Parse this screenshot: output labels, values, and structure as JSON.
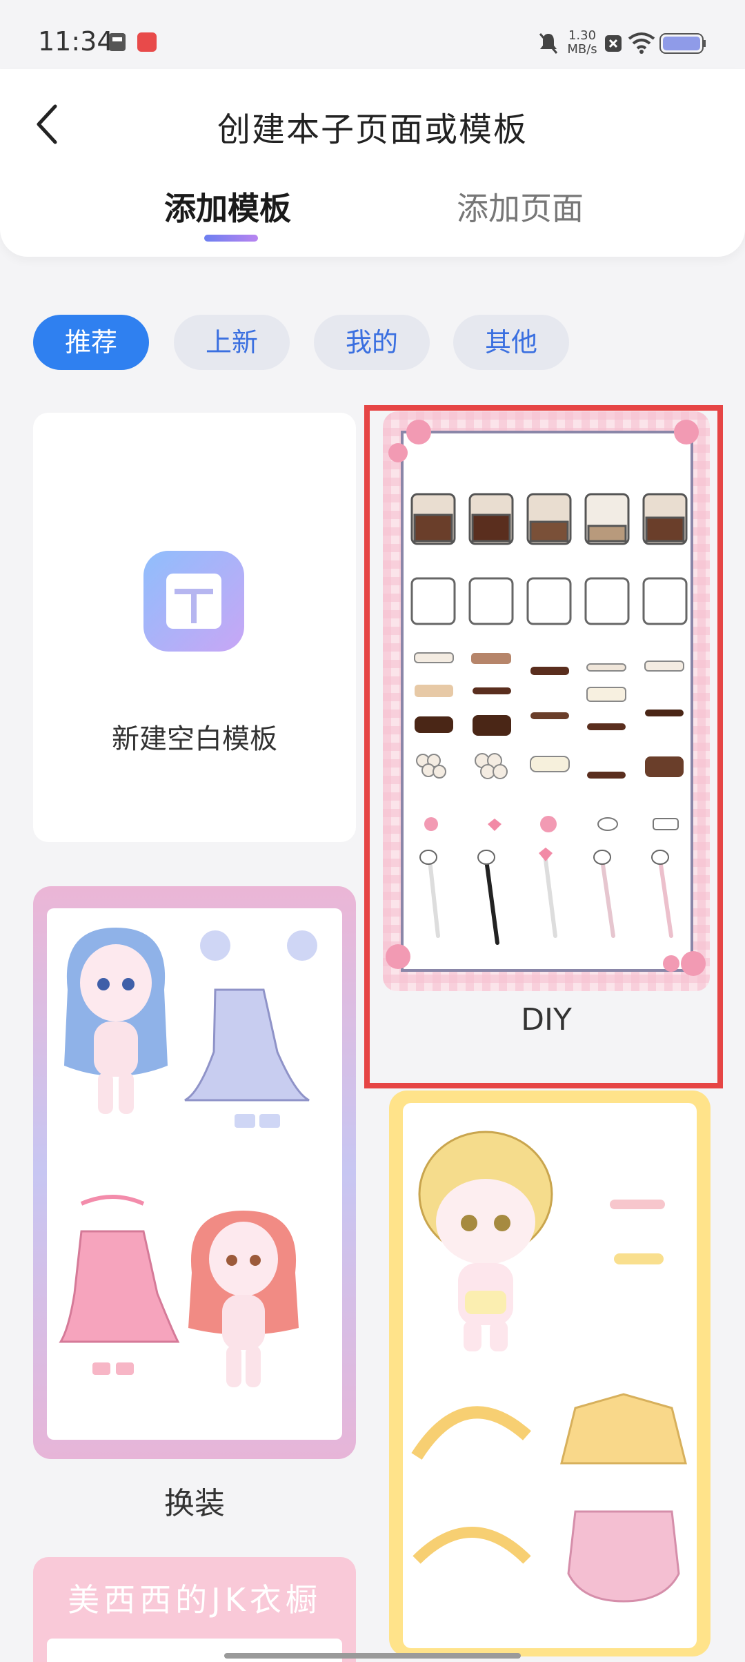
{
  "status_bar": {
    "time": "11:34",
    "speed_value": "1.30",
    "speed_unit": "MB/s"
  },
  "header": {
    "title": "创建本子页面或模板"
  },
  "tabs": [
    {
      "label": "添加模板",
      "active": true
    },
    {
      "label": "添加页面",
      "active": false
    }
  ],
  "filters": [
    {
      "label": "推荐",
      "active": true
    },
    {
      "label": "上新",
      "active": false
    },
    {
      "label": "我的",
      "active": false
    },
    {
      "label": "其他",
      "active": false
    }
  ],
  "templates": [
    {
      "label": "新建空白模板"
    },
    {
      "label": "DIY"
    },
    {
      "label": "换装"
    },
    {
      "label": ""
    },
    {
      "label": ""
    }
  ],
  "colors": {
    "accent": "#2f80f0",
    "highlight": "#e64545"
  },
  "partial_card_text": "美西西的JK衣橱"
}
